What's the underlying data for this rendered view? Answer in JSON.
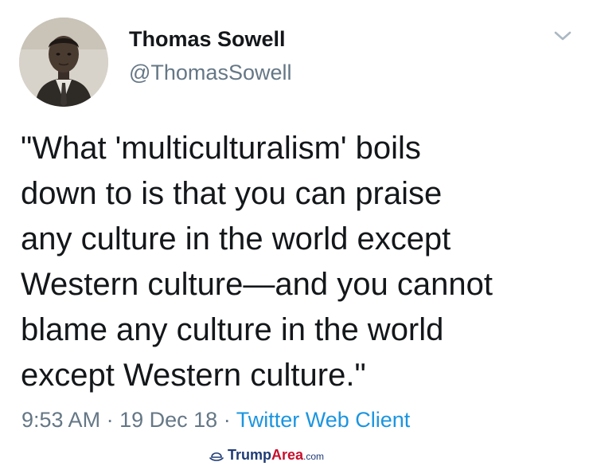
{
  "author": {
    "name": "Thomas Sowell",
    "handle": "@ThomasSowell"
  },
  "icons": {
    "menu": "chevron-down-icon",
    "watermark": "hat-logo-icon"
  },
  "tweet": {
    "lines": [
      "\"What 'multiculturalism' boils",
      "down to is that you can praise",
      "any culture in the world except",
      "Western culture—and you cannot",
      "blame any culture in the world",
      "except Western culture.\""
    ]
  },
  "meta": {
    "time": "9:53 AM",
    "separator": "·",
    "date": "19 Dec 18",
    "client": "Twitter Web Client"
  },
  "watermark": {
    "part1": "Trump",
    "part2": "Area",
    "part3": ".com"
  },
  "colors": {
    "text": "#14171a",
    "secondary": "#657786",
    "link": "#1b95e0",
    "watermark_blue": "#1f3b75",
    "watermark_red": "#c8102e"
  }
}
